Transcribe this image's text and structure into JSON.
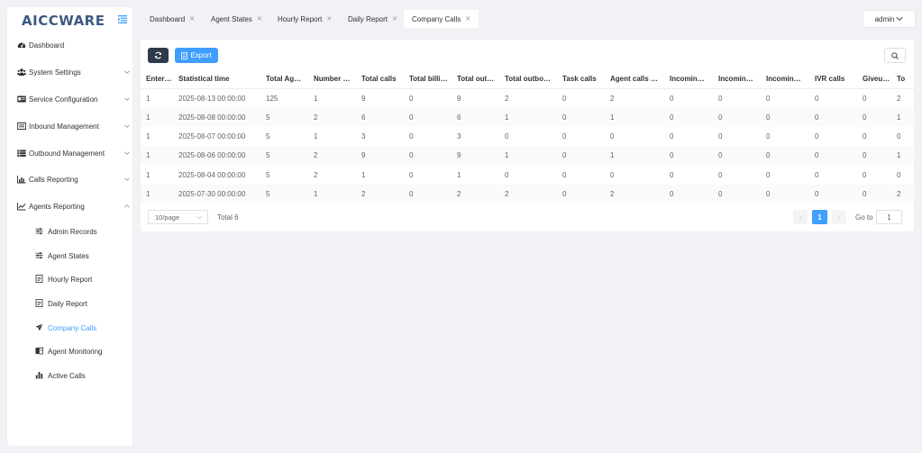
{
  "brand": {
    "logo_text": "AICCWARE"
  },
  "sidebar": {
    "items": [
      {
        "label": "Dashboard",
        "icon": "dashboard-icon"
      },
      {
        "label": "System Settings",
        "icon": "users-icon"
      },
      {
        "label": "Service Configuration",
        "icon": "id-card-icon"
      },
      {
        "label": "Inbound Management",
        "icon": "inbound-icon"
      },
      {
        "label": "Outbound Management",
        "icon": "list-icon"
      },
      {
        "label": "Calls Reporting",
        "icon": "bar-chart-icon"
      },
      {
        "label": "Agents Reporting",
        "icon": "line-chart-icon"
      }
    ],
    "sub_items": [
      {
        "label": "Admin Records",
        "icon": "sliders-icon"
      },
      {
        "label": "Agent States",
        "icon": "sliders-icon"
      },
      {
        "label": "Hourly Report",
        "icon": "document-icon"
      },
      {
        "label": "Daily Report",
        "icon": "document-icon"
      },
      {
        "label": "Company Calls",
        "icon": "paper-plane-icon",
        "active": true
      },
      {
        "label": "Agent Monitoring",
        "icon": "monitor-icon"
      },
      {
        "label": "Active Calls",
        "icon": "bar-chart-icon"
      }
    ]
  },
  "tabs": [
    {
      "label": "Dashboard"
    },
    {
      "label": "Agent States"
    },
    {
      "label": "Hourly Report"
    },
    {
      "label": "Daily Report"
    },
    {
      "label": "Company Calls",
      "active": true
    }
  ],
  "header": {
    "user_label": "admin"
  },
  "toolbar": {
    "export_label": "Export"
  },
  "table": {
    "columns": [
      "Enter…",
      "Statistical time",
      "Total Ag…",
      "Number …",
      "Total calls",
      "Total billi…",
      "Total out…",
      "Total outbo…",
      "Task calls",
      "Agent calls …",
      "Incomin…",
      "Incomin…",
      "Incomin…",
      "IVR calls",
      "Giveu…",
      "To"
    ],
    "rows": [
      [
        "1",
        "2025-08-13 00:00:00",
        "125",
        "1",
        "9",
        "0",
        "9",
        "2",
        "0",
        "2",
        "0",
        "0",
        "0",
        "0",
        "0",
        "2"
      ],
      [
        "1",
        "2025-08-08 00:00:00",
        "5",
        "2",
        "6",
        "0",
        "6",
        "1",
        "0",
        "1",
        "0",
        "0",
        "0",
        "0",
        "0",
        "1"
      ],
      [
        "1",
        "2025-08-07 00:00:00",
        "5",
        "1",
        "3",
        "0",
        "3",
        "0",
        "0",
        "0",
        "0",
        "0",
        "0",
        "0",
        "0",
        "0"
      ],
      [
        "1",
        "2025-08-06 00:00:00",
        "5",
        "2",
        "9",
        "0",
        "9",
        "1",
        "0",
        "1",
        "0",
        "0",
        "0",
        "0",
        "0",
        "1"
      ],
      [
        "1",
        "2025-08-04 00:00:00",
        "5",
        "2",
        "1",
        "0",
        "1",
        "0",
        "0",
        "0",
        "0",
        "0",
        "0",
        "0",
        "0",
        "0"
      ],
      [
        "1",
        "2025-07-30 00:00:00",
        "5",
        "1",
        "2",
        "0",
        "2",
        "2",
        "0",
        "2",
        "0",
        "0",
        "0",
        "0",
        "0",
        "2"
      ]
    ]
  },
  "pagination": {
    "page_size": "10/page",
    "total": "Total 6",
    "current_page": "1",
    "goto_label": "Go to",
    "goto_value": "1"
  },
  "colors": {
    "accent": "#409eff",
    "dark_button": "#2f3a4a",
    "logo": "#3d5a80"
  }
}
